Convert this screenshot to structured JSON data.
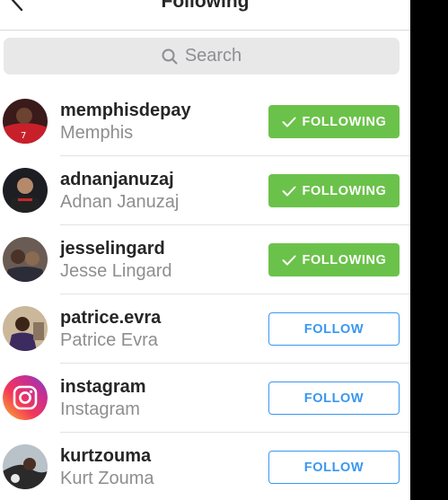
{
  "header": {
    "title": "Following",
    "back_icon": "chevron-left-icon"
  },
  "search": {
    "placeholder": "Search",
    "icon": "search-icon"
  },
  "colors": {
    "following_bg": "#6bc24a",
    "follow_blue": "#3897f0"
  },
  "users": [
    {
      "username": "memphisdepay",
      "name": "Memphis",
      "button": "FOLLOWING",
      "state": "following"
    },
    {
      "username": "adnanjanuzaj",
      "name": "Adnan Januzaj",
      "button": "FOLLOWING",
      "state": "following"
    },
    {
      "username": "jesselingard",
      "name": "Jesse Lingard",
      "button": "FOLLOWING",
      "state": "following"
    },
    {
      "username": "patrice.evra",
      "name": "Patrice Evra",
      "button": "FOLLOW",
      "state": "follow"
    },
    {
      "username": "instagram",
      "name": "Instagram",
      "button": "FOLLOW",
      "state": "follow"
    },
    {
      "username": "kurtzouma",
      "name": "Kurt Zouma",
      "button": "FOLLOW",
      "state": "follow"
    }
  ]
}
